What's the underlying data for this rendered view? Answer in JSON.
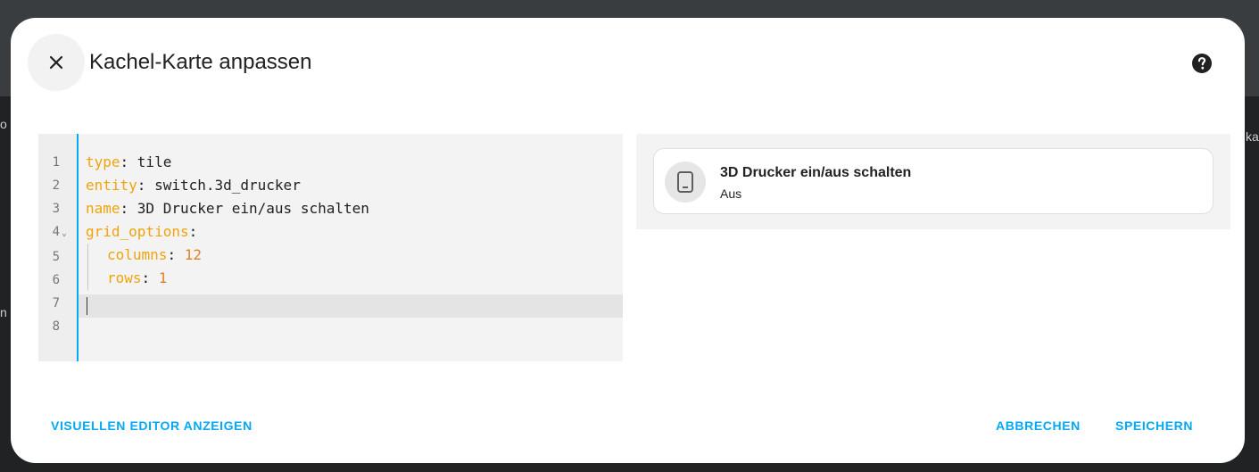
{
  "backdrop": {
    "edge_left_1": "o",
    "edge_left_2": "n",
    "edge_right": "ka"
  },
  "dialog": {
    "title": "Kachel-Karte anpassen",
    "close_icon": "close-icon",
    "help_icon": "help-circle-icon"
  },
  "editor": {
    "line_numbers": [
      "1",
      "2",
      "3",
      "4",
      "5",
      "6",
      "7",
      "8"
    ],
    "lines": [
      {
        "key": "type",
        "sep": ": ",
        "value": "tile"
      },
      {
        "key": "entity",
        "sep": ": ",
        "value": "switch.3d_drucker"
      },
      {
        "key": "name",
        "sep": ": ",
        "value": "3D Drucker ein/aus schalten"
      },
      {
        "key": "grid_options",
        "sep": ":",
        "value": ""
      },
      {
        "key": "columns",
        "sep": ": ",
        "value": "12"
      },
      {
        "key": "rows",
        "sep": ": ",
        "value": "1"
      }
    ],
    "fold_marker": "⌄"
  },
  "preview": {
    "tile_name": "3D Drucker ein/aus schalten",
    "tile_state": "Aus",
    "tile_icon": "power-socket-icon"
  },
  "footer": {
    "visual_editor": "VISUELLEN EDITOR ANZEIGEN",
    "cancel": "ABBRECHEN",
    "save": "SPEICHERN"
  },
  "colors": {
    "accent": "#03a9f4",
    "yaml_key": "#f0a30a",
    "yaml_number": "#e67e22"
  }
}
